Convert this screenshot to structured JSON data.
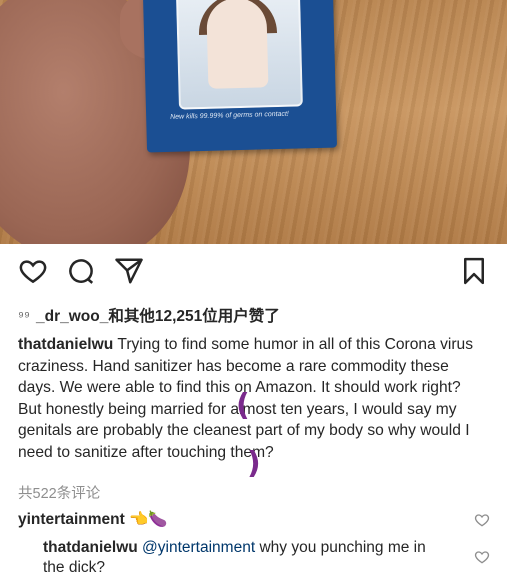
{
  "photo": {
    "package_text": "New kills 99.99% of germs on contact!"
  },
  "actions": {
    "icons": [
      "heart-icon",
      "comment-icon",
      "share-icon",
      "bookmark-icon"
    ]
  },
  "likes": {
    "prefix": "⁹⁹",
    "text": "_dr_woo_和其他12,251位用户赞了"
  },
  "caption": {
    "username": "thatdanielwu",
    "text": "Trying to find some humor in all of this Corona virus craziness. Hand sanitizer has become a rare commodity these days. We were able to find this on Amazon. It should work right? But honestly being married for almost ten years, I would say my genitals are probably the cleanest part of my body so why would I need to sanitize after touching them?"
  },
  "comments_count": "共522条评论",
  "comments": [
    {
      "username": "yintertainment",
      "text": "👈🍆"
    },
    {
      "username": "thatdanielwu",
      "mention": "@yintertainment",
      "text": " why you punching me in the dick?"
    }
  ]
}
